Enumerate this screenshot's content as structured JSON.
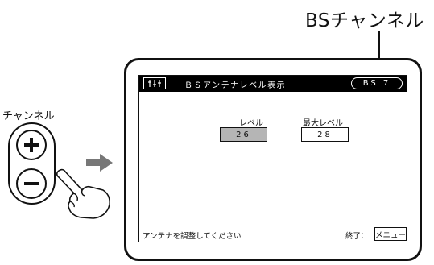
{
  "callout": {
    "label": "BSチャンネル"
  },
  "osd": {
    "title": "ＢＳアンテナレベル表示",
    "channel_badge": "BS 7",
    "level": {
      "label": "レベル",
      "value": "26"
    },
    "max_level": {
      "label": "最大レベル",
      "value": "28"
    },
    "footer": {
      "message": "アンテナを調整してください",
      "exit_label": "終了：",
      "menu_button": "メニュー"
    }
  },
  "remote": {
    "label": "チャンネル"
  },
  "icons": [
    "menu-adjust-icon",
    "plus-icon",
    "minus-icon",
    "arrow-right-icon",
    "pressing-hand-icon"
  ],
  "colors": {
    "header_bg": "#000000",
    "active_value_bg": "#b5b5b5"
  }
}
